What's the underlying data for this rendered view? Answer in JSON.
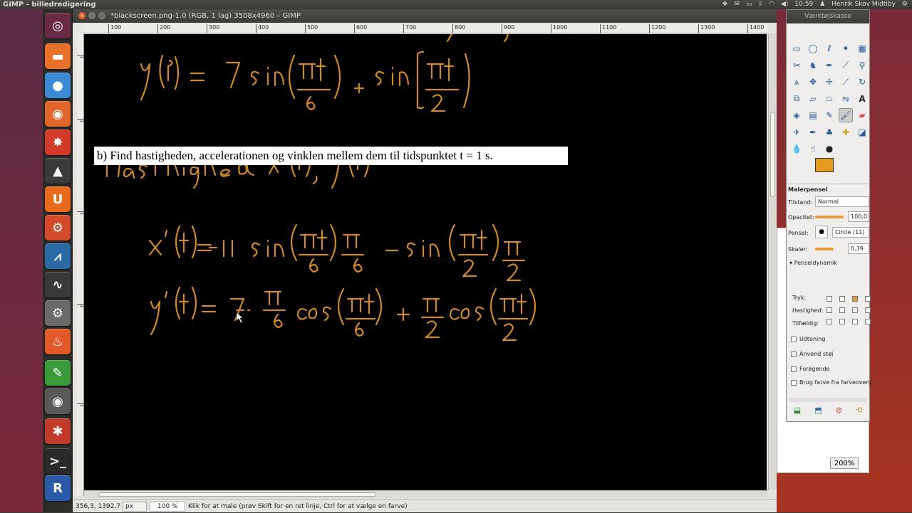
{
  "topbar": {
    "app_title": "GIMP - billedredigering",
    "clock": "10:59",
    "user": "Henrik Skov Midtiby"
  },
  "window": {
    "title": "*blackscreen.png-1.0 (RGB, 1 lag) 3508x4960 – GIMP"
  },
  "ruler": {
    "h_ticks": [
      "100",
      "200",
      "300",
      "400",
      "500",
      "600",
      "700",
      "800",
      "900",
      "1000",
      "1100",
      "1200",
      "1300",
      "1400"
    ]
  },
  "canvas": {
    "problem_text": "b) Find hastigheden, accelerationen og vinklen mellem dem til tidspunktet  t = 1 s."
  },
  "statusbar": {
    "coords": "356,3, 1392,7",
    "unit": "px",
    "zoom": "100 %",
    "message": "Klik for at male (prøv Skift for en ret linje, Ctrl for at vælge en farve)"
  },
  "toolbox": {
    "title": "Værktøjskasse",
    "fg_color": "#e59b1e",
    "bg_color": "#000000",
    "options_title": "Malerpensel",
    "mode_label": "Tilstand:",
    "mode_value": "Normal",
    "opacity_label": "Opacitet:",
    "opacity_value": "100,0",
    "brush_label": "Pensel:",
    "brush_value": "Circle (11)",
    "scale_label": "Skaler:",
    "scale_value": "0,39",
    "dynamics_label": "Penseldynamik",
    "dyn_cols": [
      "Opacitet",
      "Hårdhed",
      "Størrelse",
      "Farve"
    ],
    "dyn_rows": [
      "Tryk:",
      "Hastighed:",
      "Tilfældig:"
    ],
    "options": [
      "Udtoning",
      "Anvend støj",
      "Forøgende",
      "Brug farve fra farveoverg"
    ]
  },
  "behind": {
    "zoom": "200%"
  }
}
